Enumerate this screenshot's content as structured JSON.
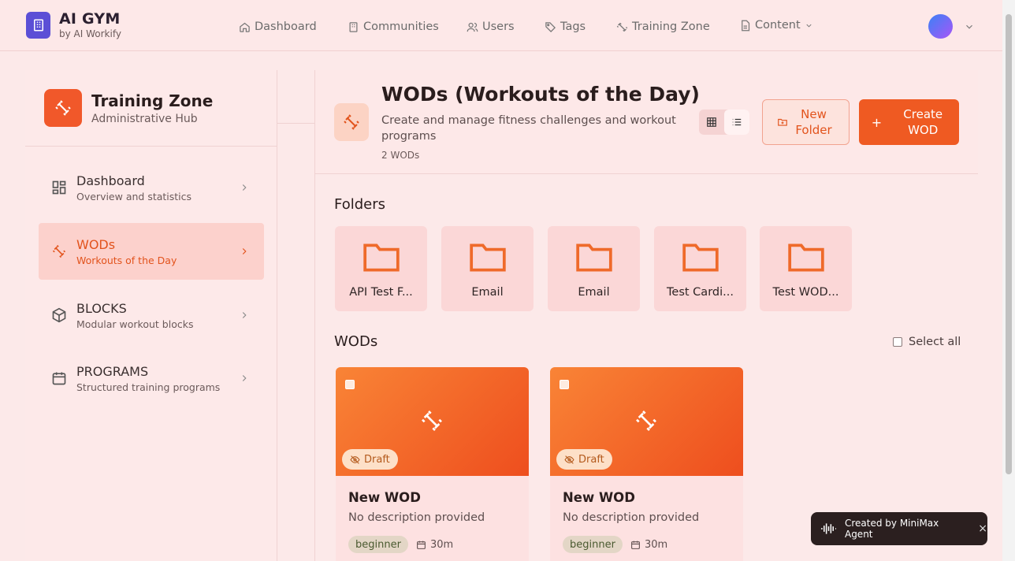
{
  "brand": {
    "title": "AI GYM",
    "subtitle": "by AI Workify"
  },
  "nav": {
    "dashboard": "Dashboard",
    "communities": "Communities",
    "users": "Users",
    "tags": "Tags",
    "training_zone": "Training Zone",
    "content": "Content"
  },
  "sidebar": {
    "title": "Training Zone",
    "subtitle": "Administrative Hub",
    "items": [
      {
        "label": "Dashboard",
        "sub": "Overview and statistics"
      },
      {
        "label": "WODs",
        "sub": "Workouts of the Day"
      },
      {
        "label": "BLOCKS",
        "sub": "Modular workout blocks"
      },
      {
        "label": "PROGRAMS",
        "sub": "Structured training programs"
      }
    ]
  },
  "header": {
    "title": "WODs (Workouts of the Day)",
    "description": "Create and manage fitness challenges and workout programs",
    "count": "2 WODs",
    "new_folder": "New Folder",
    "create_wod": "Create WOD"
  },
  "folders": {
    "title": "Folders",
    "items": [
      "API Test F...",
      "Email",
      "Email",
      "Test Cardi...",
      "Test WOD..."
    ]
  },
  "wods": {
    "title": "WODs",
    "select_all": "Select all",
    "cards": [
      {
        "status": "Draft",
        "title": "New WOD",
        "description": "No description provided",
        "level": "beginner",
        "duration": "30m"
      },
      {
        "status": "Draft",
        "title": "New WOD",
        "description": "No description provided",
        "level": "beginner",
        "duration": "30m"
      }
    ]
  },
  "toast": {
    "text": "Created by MiniMax Agent",
    "close": "×"
  },
  "colors": {
    "accent": "#ef5a22",
    "brand": "#5b4fd6",
    "background": "#fce9e9"
  }
}
